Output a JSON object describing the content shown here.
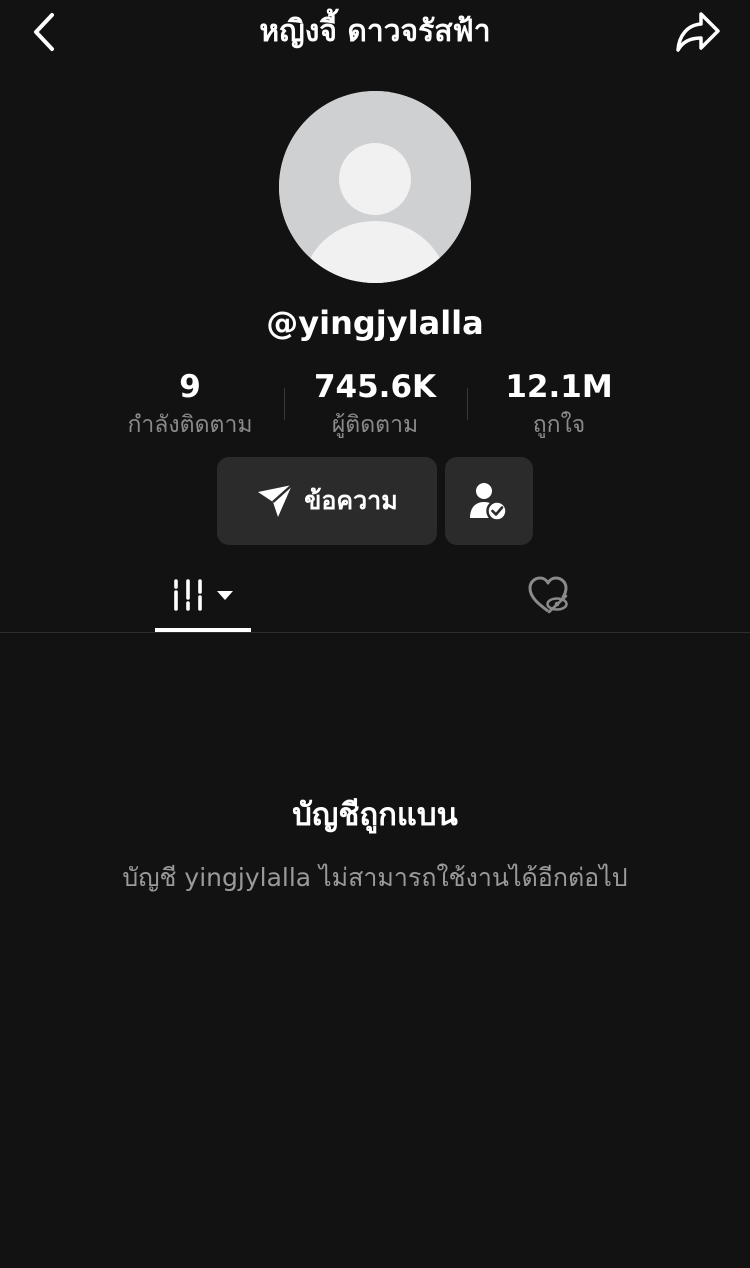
{
  "header": {
    "title": "หญิงจี้ ดาวจรัสฟ้า",
    "back_icon": "chevron-left-icon",
    "share_icon": "share-arrow-icon"
  },
  "profile": {
    "avatar_icon": "default-avatar-icon",
    "username": "@yingjylalla"
  },
  "stats": [
    {
      "value": "9",
      "label": "กำลังติดตาม"
    },
    {
      "value": "745.6K",
      "label": "ผู้ติดตาม"
    },
    {
      "value": "12.1M",
      "label": "ถูกใจ"
    }
  ],
  "actions": {
    "message_label": "ข้อความ",
    "message_icon": "send-icon",
    "follow_status_icon": "user-check-icon"
  },
  "tabs": {
    "videos_icon": "grid-bars-icon",
    "videos_dropdown_icon": "caret-down-icon",
    "liked_icon": "hidden-heart-icon",
    "active": "videos"
  },
  "banned": {
    "title": "บัญชีถูกแบน",
    "description": "บัญชี yingjylalla ไม่สามารถใช้งานได้อีกต่อไป"
  },
  "colors": {
    "background": "#121212",
    "button_bg": "#2b2b2b",
    "muted_text": "#8a8a8a",
    "avatar_bg": "#cfd0d2"
  }
}
